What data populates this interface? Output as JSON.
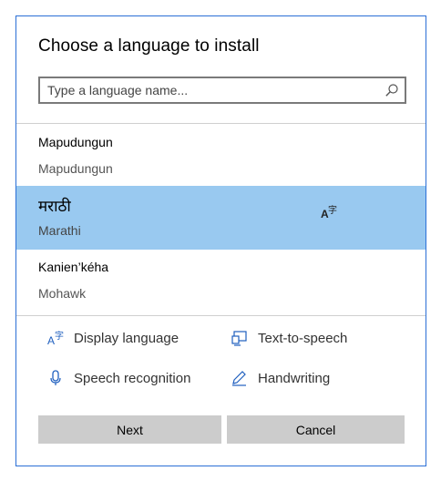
{
  "dialog": {
    "title": "Choose a language to install",
    "search": {
      "placeholder": "Type a language name...",
      "value": ""
    },
    "languages": [
      {
        "native": "Mapudungun",
        "english": "Mapudungun",
        "selected": false,
        "features": []
      },
      {
        "native": "मराठी",
        "english": "Marathi",
        "selected": true,
        "features": [
          "display-language-icon"
        ]
      },
      {
        "native": "Kanien’kéha",
        "english": "Mohawk",
        "selected": false,
        "features": []
      }
    ],
    "legend": {
      "display_language": "Display language",
      "text_to_speech": "Text-to-speech",
      "speech_recognition": "Speech recognition",
      "handwriting": "Handwriting"
    },
    "buttons": {
      "next": "Next",
      "cancel": "Cancel"
    },
    "colors": {
      "accent": "#2b6fd6",
      "selection": "#99c9f0",
      "button": "#cccccc",
      "icon_blue": "#1f5fbf"
    }
  }
}
